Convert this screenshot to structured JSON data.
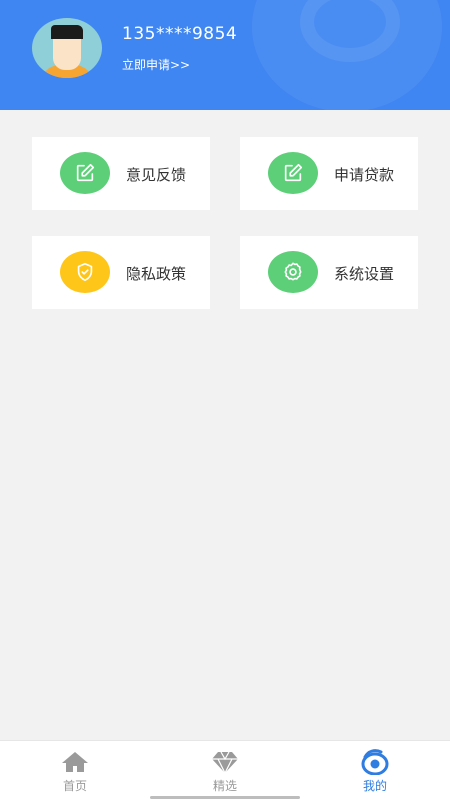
{
  "header": {
    "phone": "135****9854",
    "apply_link": "立即申请>>"
  },
  "menu": {
    "items": [
      {
        "label": "意见反馈",
        "icon": "edit-icon",
        "color": "#5ccf78"
      },
      {
        "label": "申请贷款",
        "icon": "edit-icon",
        "color": "#5ccf78"
      },
      {
        "label": "隐私政策",
        "icon": "shield-icon",
        "color": "#ffc61a"
      },
      {
        "label": "系统设置",
        "icon": "gear-icon",
        "color": "#5ccf78"
      }
    ]
  },
  "bottom_nav": {
    "items": [
      {
        "label": "首页",
        "icon": "home-icon",
        "active": false
      },
      {
        "label": "精选",
        "icon": "diamond-icon",
        "active": false
      },
      {
        "label": "我的",
        "icon": "profile-icon",
        "active": true
      }
    ]
  },
  "colors": {
    "header_bg": "#3f86f2",
    "accent": "#2f7de1",
    "page_bg": "#f2f2f2"
  }
}
